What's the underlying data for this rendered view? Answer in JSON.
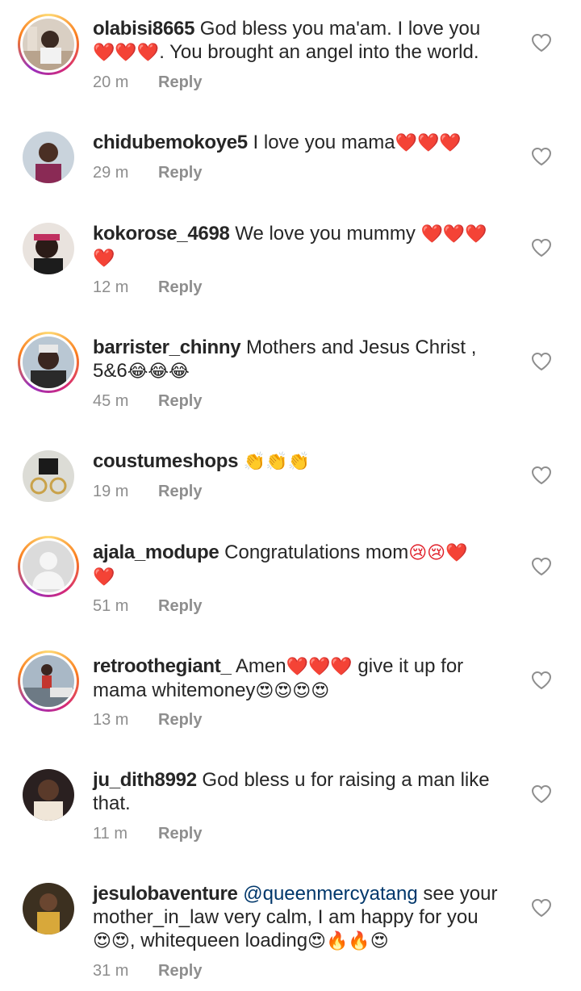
{
  "reply_label": "Reply",
  "comments": [
    {
      "username": "olabisi8665",
      "text": "God bless you ma'am. I love you",
      "text2": "❤️❤️❤️",
      "text3": ". You brought an angel into the world.",
      "time": "20 m",
      "story": true
    },
    {
      "username": "chidubemokoye5",
      "text": "I love you mama",
      "text2": "❤️❤️❤️",
      "time": "29 m",
      "story": false
    },
    {
      "username": "kokorose_4698",
      "text": "We love you mummy",
      "text2": "❤️❤️❤️",
      "text3": "❤️",
      "time": "12 m",
      "story": false
    },
    {
      "username": "barrister_chinny",
      "text": "Mothers and Jesus Christ ,",
      "text2": "5&6",
      "text3": "😂😂😂",
      "time": "45 m",
      "story": true
    },
    {
      "username": "coustumeshops",
      "text": "👏👏👏",
      "time": "19 m",
      "story": false
    },
    {
      "username": "ajala_modupe",
      "text": "Congratulations mom",
      "text2": "😢😢❤️",
      "text3": "❤️",
      "time": "51 m",
      "story": true
    },
    {
      "username": "retroothegiant_",
      "text": "Amen",
      "text2": "❤️❤️❤️",
      "text3": " give it up for",
      "text4": "mama whitemoney",
      "text5": "😍😍😍😍",
      "time": "13 m",
      "story": true
    },
    {
      "username": "ju_dith8992",
      "text": "God bless u for raising a man like that.",
      "time": "11 m",
      "story": false
    },
    {
      "username": "jesulobaventure",
      "mention": "@queenmercyatang",
      "text": " see your mother_in_law very calm, I am happy for you",
      "text2": "😍😍",
      "text3": ", whitequeen loading",
      "text4": "😍🔥🔥😍",
      "time": "31 m",
      "story": false
    }
  ],
  "colors": {
    "text": "#262626",
    "meta": "#8e8e8e",
    "mention": "#00376b",
    "heart": "#e0202a"
  },
  "icons": {
    "like": "heart-outline-icon"
  }
}
